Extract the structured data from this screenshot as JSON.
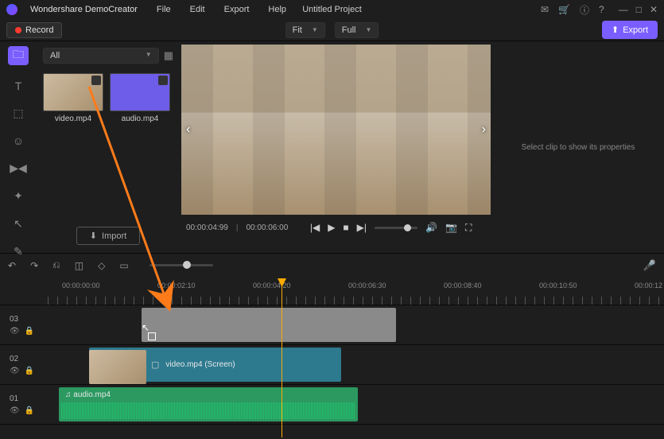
{
  "app": {
    "name": "Wondershare DemoCreator",
    "title": "Untitled Project"
  },
  "menu": {
    "file": "File",
    "edit": "Edit",
    "export": "Export",
    "help": "Help"
  },
  "toolbar": {
    "record": "Record",
    "fit1": "Fit",
    "fit2": "Full",
    "export": "Export"
  },
  "media": {
    "all": "All",
    "import": "Import",
    "thumbs": [
      {
        "name": "video.mp4"
      },
      {
        "name": "audio.mp4"
      }
    ]
  },
  "player": {
    "current": "00:00:04:99",
    "total": "00:00:06:00"
  },
  "props": {
    "empty": "Select clip to show its properties"
  },
  "ruler": {
    "t0": "00:00:00:00",
    "t1": "00:00:02:10",
    "t2": "00:00:04:20",
    "t3": "00:00:06:30",
    "t4": "00:00:08:40",
    "t5": "00:00:10:50",
    "t6": "00:00:12"
  },
  "tracks": {
    "t3": {
      "num": "03"
    },
    "t2": {
      "num": "02",
      "clip": "video.mp4 (Screen)"
    },
    "t1": {
      "num": "01",
      "clip": "audio.mp4"
    }
  }
}
